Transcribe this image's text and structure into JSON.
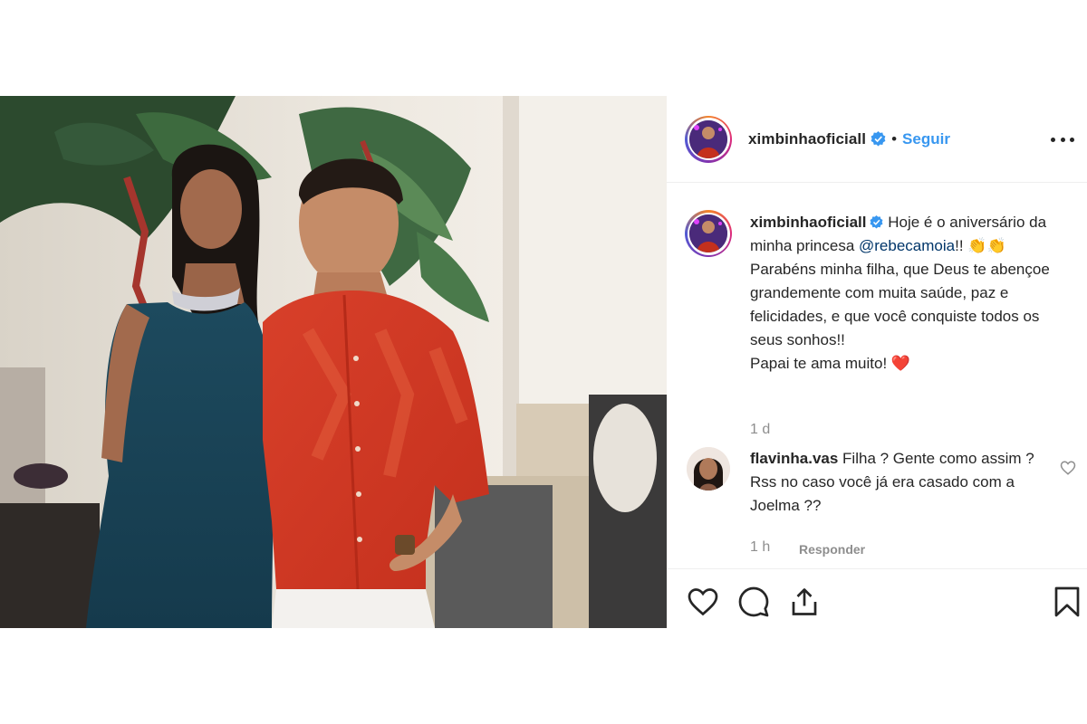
{
  "post": {
    "username": "ximbinhaoficiall",
    "verified_icon": "verified-badge-icon",
    "separator": "•",
    "follow_label": "Seguir",
    "more_icon": "more-options-icon",
    "caption": {
      "username": "ximbinhaoficiall",
      "text_before_mention": "Hoje é o aniversário da minha princesa ",
      "mention": "@rebecamoia",
      "text_after_mention": "!! ",
      "emoji_1": "👏",
      "emoji_2": "👏",
      "body": " Parabéns minha filha, que Deus te abençoe grandemente com muita saúde, paz e felicidades, e que você conquiste todos os seus sonhos!!",
      "line_last": "Papai te ama muito! ",
      "heart_emoji": "❤️"
    },
    "time_ago": "1 d",
    "comment": {
      "username": "flavinha.vas",
      "text": " Filha ? Gente como assim ? Rss no caso você já era casado com a Joelma ??",
      "time": "1 h",
      "reply_label": "Responder"
    },
    "colors": {
      "link": "#3897f0",
      "mention": "#003569",
      "muted": "#8e8e8e",
      "text": "#262626",
      "heart": "#ed4956"
    },
    "action_icons": [
      "heart-icon",
      "comment-icon",
      "share-icon",
      "bookmark-icon"
    ]
  }
}
